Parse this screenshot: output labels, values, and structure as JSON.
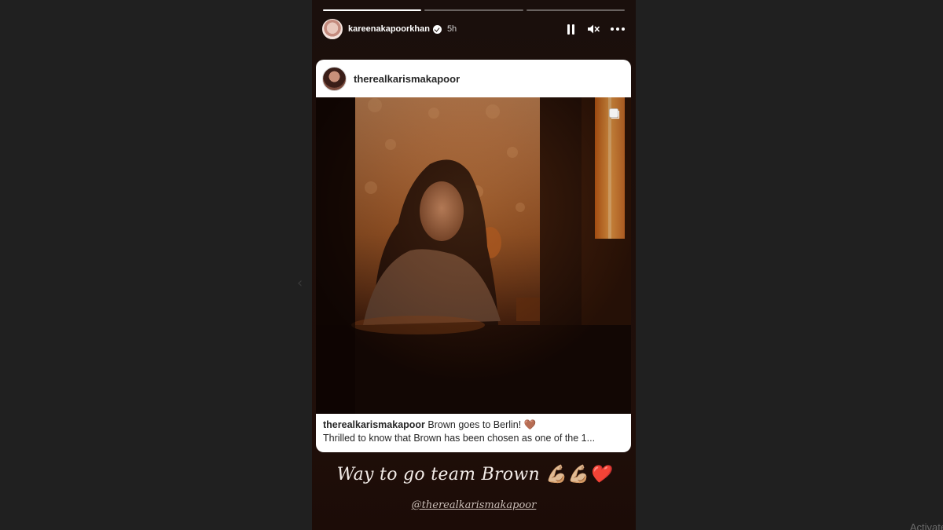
{
  "story": {
    "progress": [
      1.0,
      0.0,
      0.0
    ],
    "username": "kareenakapoorkhan",
    "time": "5h"
  },
  "post": {
    "username": "therealkarismakapoor",
    "caption_user": "therealkarismakapoor",
    "caption_text": " Brown goes to Berlin! 🤎",
    "caption_line2": "Thrilled to know that Brown has been chosen as one of the 1..."
  },
  "overlay": {
    "tagline": "Way to go team Brown 💪🏼💪🏼❤️",
    "mention": "@therealkarismakapoor"
  },
  "icons": [
    "pause-icon",
    "mute-icon",
    "more-icon",
    "verified-icon",
    "carousel-icon",
    "chevron-left-icon"
  ],
  "colors": {
    "page_bg": "#202020",
    "story_bg": "#1d0e09",
    "card_bg": "#ffffff"
  },
  "watermark": "Activate W"
}
